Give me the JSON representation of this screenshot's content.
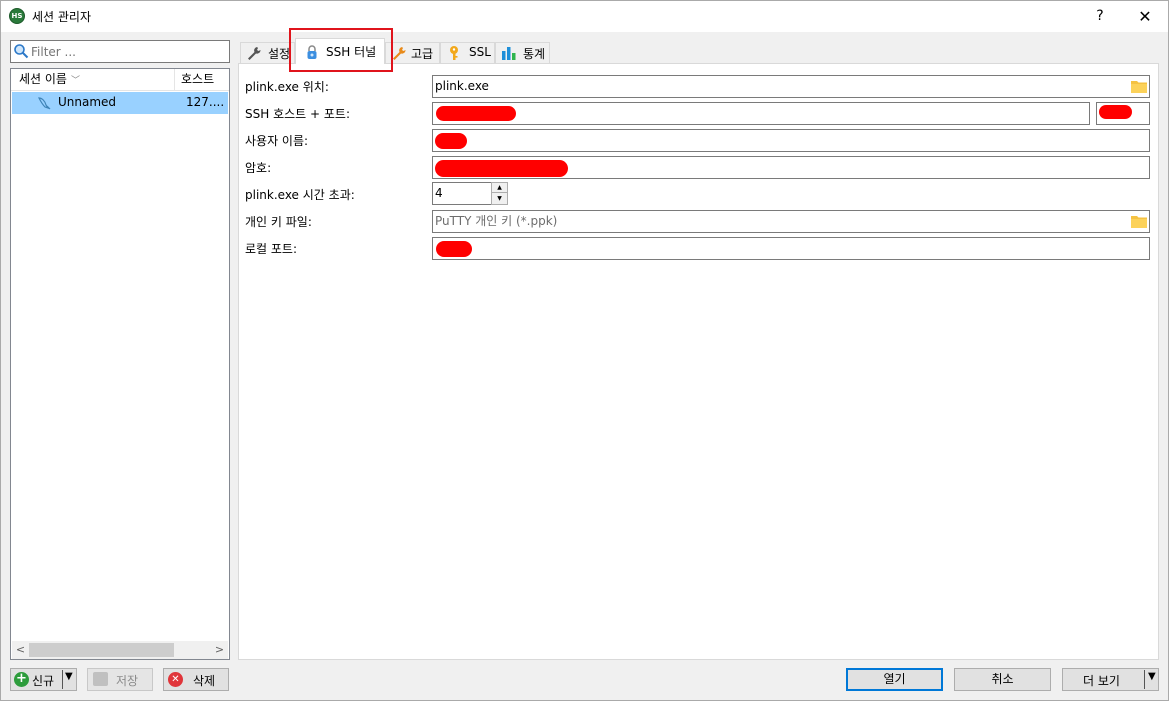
{
  "window": {
    "title": "세션 관리자",
    "app_icon_text": "HS",
    "help_label": "?",
    "close_label": "✕"
  },
  "left": {
    "filter_placeholder": "Filter ...",
    "columns": {
      "name": "세션 이름",
      "host": "호스트"
    },
    "sessions": [
      {
        "name": "Unnamed",
        "host": "127...."
      }
    ],
    "buttons": {
      "new": "신규",
      "save": "저장",
      "delete": "삭제"
    }
  },
  "tabs": [
    {
      "label": "설정",
      "icon": "wrench-icon"
    },
    {
      "label": "SSH 터널",
      "icon": "lock-icon",
      "active": true
    },
    {
      "label": "고급",
      "icon": "wrench-icon"
    },
    {
      "label": "SSL",
      "icon": "key-icon"
    },
    {
      "label": "통계",
      "icon": "bar-chart-icon"
    }
  ],
  "ssh_tunnel": {
    "plink_location_label": "plink.exe 위치:",
    "plink_location_value": "plink.exe",
    "ssh_host_port_label": "SSH 호스트 + 포트:",
    "username_label": "사용자 이름:",
    "password_label": "암호:",
    "timeout_label": "plink.exe 시간 초과:",
    "timeout_value": "4",
    "private_key_label": "개인 키 파일:",
    "private_key_placeholder": "PuTTY 개인 키 (*.ppk)",
    "local_port_label": "로컬 포트:"
  },
  "footer": {
    "open": "열기",
    "cancel": "취소",
    "more": "더 보기"
  },
  "colors": {
    "selection": "#99d1ff",
    "highlight_box": "#e0141c",
    "redaction": "#ff0000",
    "default_button_border": "#0078d7"
  }
}
